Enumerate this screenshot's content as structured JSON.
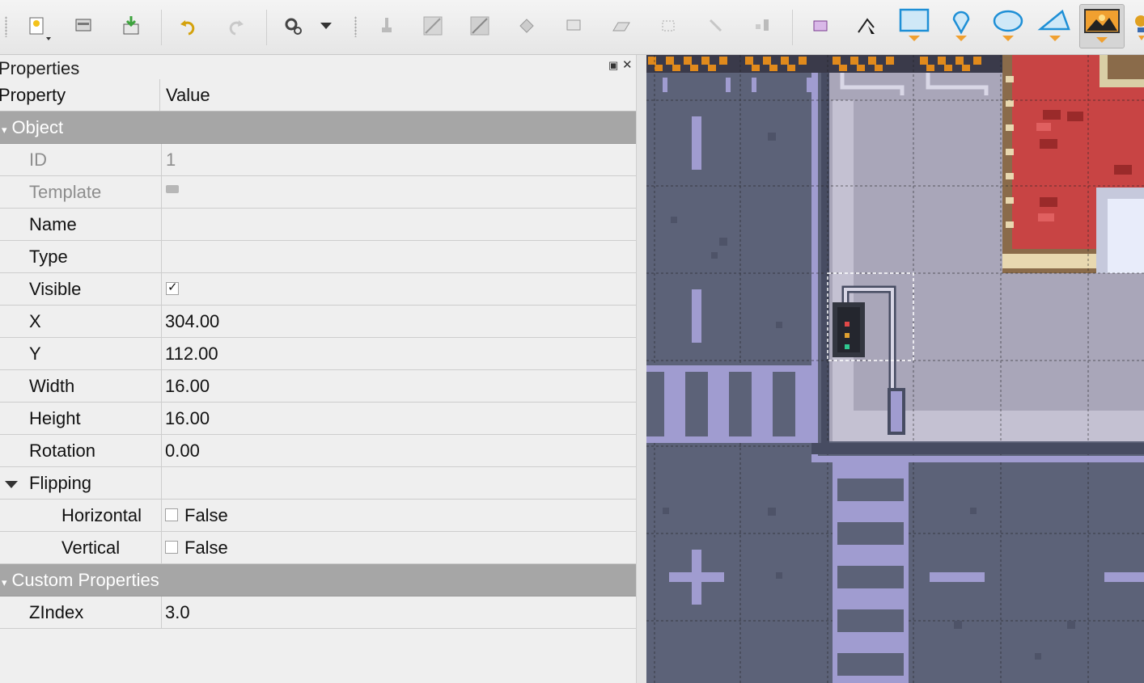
{
  "toolbar": {
    "tools": [
      {
        "name": "new-file-icon"
      },
      {
        "name": "open-file-icon"
      },
      {
        "name": "save-file-icon"
      },
      {
        "name": "undo-icon"
      },
      {
        "name": "redo-icon"
      },
      {
        "name": "commands-icon"
      },
      {
        "name": "stamp-brush-icon"
      },
      {
        "name": "terrain-brush-icon"
      },
      {
        "name": "wang-brush-icon"
      },
      {
        "name": "bucket-fill-icon"
      },
      {
        "name": "shape-fill-icon"
      },
      {
        "name": "eraser-icon"
      },
      {
        "name": "rect-select-icon"
      },
      {
        "name": "magic-wand-icon"
      },
      {
        "name": "select-same-tile-icon"
      },
      {
        "name": "select-objects-icon"
      },
      {
        "name": "edit-polygons-icon"
      },
      {
        "name": "insert-rectangle-icon"
      },
      {
        "name": "insert-point-icon"
      },
      {
        "name": "insert-ellipse-icon"
      },
      {
        "name": "insert-polygon-icon"
      },
      {
        "name": "insert-tile-icon"
      },
      {
        "name": "insert-template-icon"
      }
    ],
    "active_tool": "insert-tile-icon",
    "accent_color": "#1e8fd6"
  },
  "properties_panel": {
    "title": "Properties",
    "columns": {
      "property": "Property",
      "value": "Value"
    },
    "object_group": "Object",
    "id": {
      "label": "ID",
      "value": "1"
    },
    "template": {
      "label": "Template",
      "value": ""
    },
    "name": {
      "label": "Name",
      "value": ""
    },
    "type": {
      "label": "Type",
      "value": ""
    },
    "visible": {
      "label": "Visible",
      "checked": true
    },
    "x": {
      "label": "X",
      "value": "304.00"
    },
    "y": {
      "label": "Y",
      "value": "112.00"
    },
    "width": {
      "label": "Width",
      "value": "16.00"
    },
    "height": {
      "label": "Height",
      "value": "16.00"
    },
    "rotation": {
      "label": "Rotation",
      "value": "0.00"
    },
    "flipping": {
      "label": "Flipping"
    },
    "horizontal": {
      "label": "Horizontal",
      "value": "False"
    },
    "vertical": {
      "label": "Vertical",
      "value": "False"
    },
    "custom_group": "Custom Properties",
    "zindex": {
      "label": "ZIndex",
      "value": "3.0"
    }
  },
  "map": {
    "colors": {
      "asphalt": "#5c6278",
      "sidewalk": "#a9a6b9",
      "stripe": "#a09cd0",
      "carpet": "#c84444",
      "hazard": "#e08a1c"
    }
  }
}
